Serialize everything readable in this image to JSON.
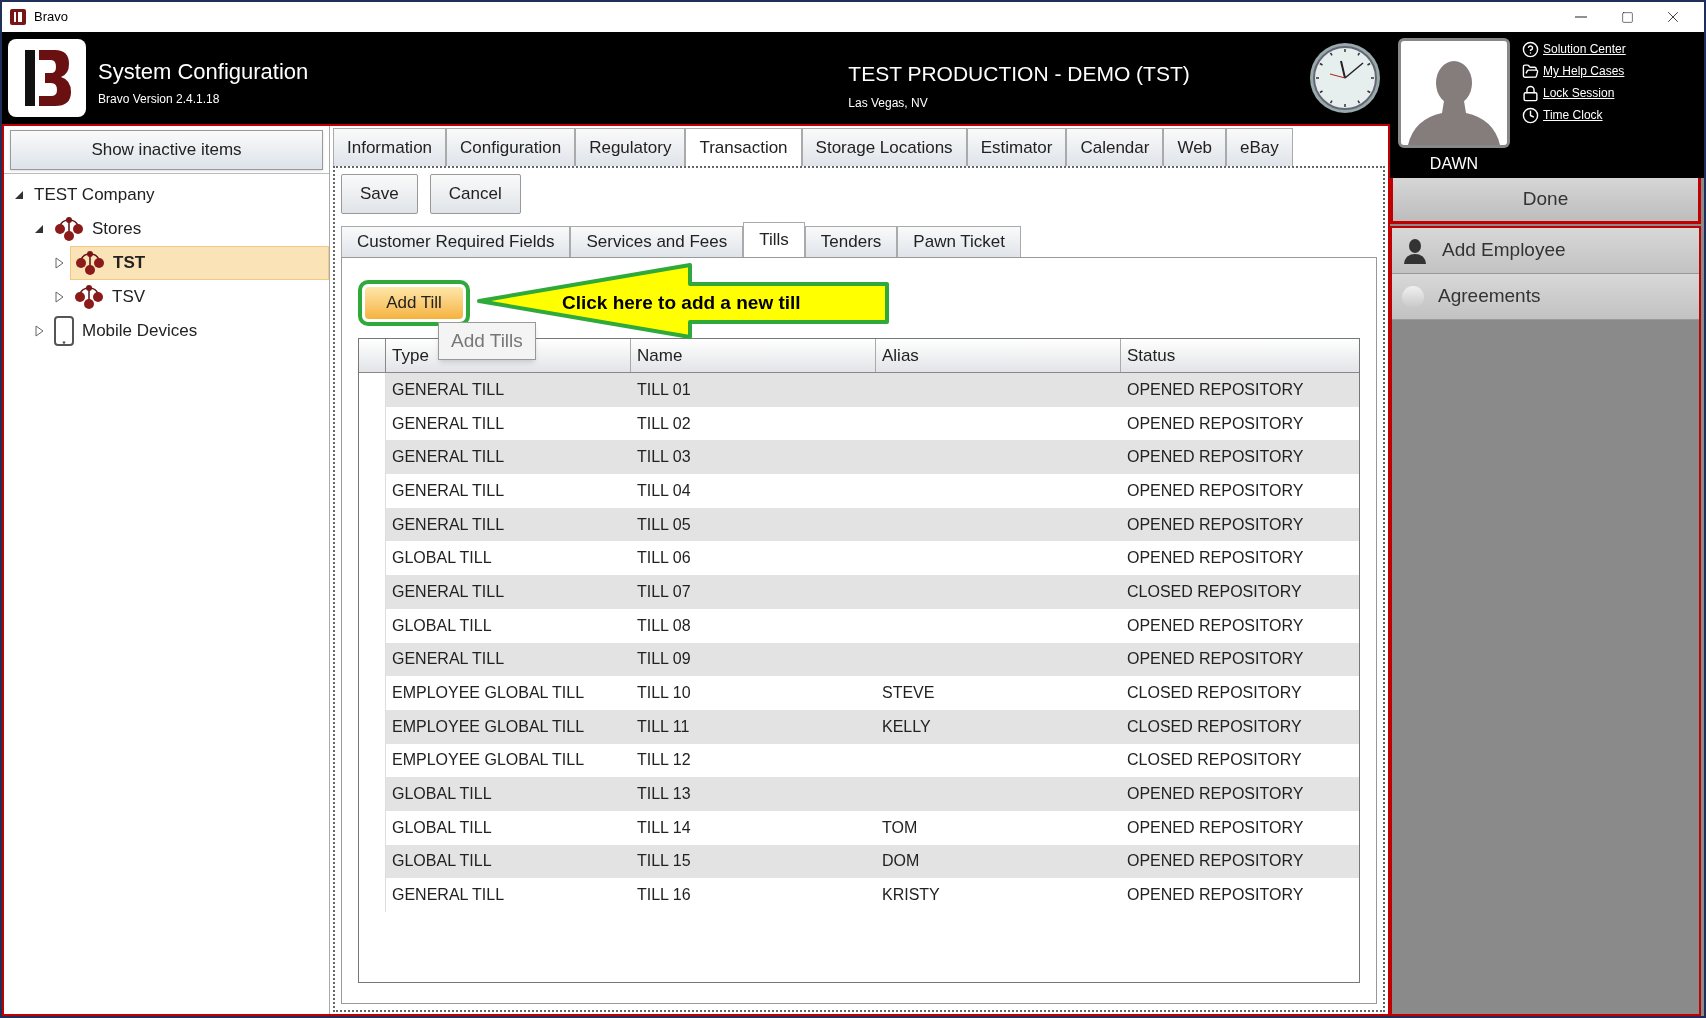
{
  "window": {
    "title": "Bravo"
  },
  "header": {
    "app_title": "System Configuration",
    "version": "Bravo Version 2.4.1.18",
    "company_title": "TEST PRODUCTION - DEMO (TST)",
    "location": "Las Vegas, NV",
    "user_name": "DAWN",
    "links": [
      {
        "label": "Solution Center",
        "kind": "help"
      },
      {
        "label": "My Help Cases",
        "kind": "folder"
      },
      {
        "label": "Lock Session",
        "kind": "lock"
      },
      {
        "label": "Time Clock",
        "kind": "clock"
      }
    ]
  },
  "sidebar": {
    "button": "Show inactive items",
    "tree": [
      {
        "label": "TEST Company",
        "expanded": true,
        "selected": false,
        "children": [
          {
            "label": "Stores",
            "kind": "stores",
            "expanded": true,
            "selected": false,
            "children": [
              {
                "label": "TST",
                "kind": "store",
                "expanded": false,
                "selected": true
              },
              {
                "label": "TSV",
                "kind": "store",
                "expanded": false,
                "selected": false
              }
            ]
          },
          {
            "label": "Mobile Devices",
            "kind": "device",
            "expanded": false,
            "selected": false
          }
        ]
      }
    ]
  },
  "tabs": [
    {
      "label": "Information",
      "selected": false
    },
    {
      "label": "Configuration",
      "selected": false
    },
    {
      "label": "Regulatory",
      "selected": false
    },
    {
      "label": "Transaction",
      "selected": true
    },
    {
      "label": "Storage Locations",
      "selected": false
    },
    {
      "label": "Estimator",
      "selected": false
    },
    {
      "label": "Calendar",
      "selected": false
    },
    {
      "label": "Web",
      "selected": false
    },
    {
      "label": "eBay",
      "selected": false
    }
  ],
  "toolbar": [
    "Save",
    "Cancel"
  ],
  "subtabs": [
    {
      "label": "Customer Required Fields",
      "selected": false
    },
    {
      "label": "Services and Fees",
      "selected": false
    },
    {
      "label": "Tills",
      "selected": true
    },
    {
      "label": "Tenders",
      "selected": false
    },
    {
      "label": "Pawn Ticket",
      "selected": false
    }
  ],
  "add_button": "Add Till",
  "tooltip": "Add Tills",
  "callout": "Click here to add a new till",
  "table": {
    "columns": [
      "Type",
      "Name",
      "Alias",
      "Status"
    ],
    "rows": [
      [
        "GENERAL TILL",
        "TILL 01",
        "",
        "OPENED REPOSITORY"
      ],
      [
        "GENERAL TILL",
        "TILL 02",
        "",
        "OPENED REPOSITORY"
      ],
      [
        "GENERAL TILL",
        "TILL 03",
        "",
        "OPENED REPOSITORY"
      ],
      [
        "GENERAL TILL",
        "TILL 04",
        "",
        "OPENED REPOSITORY"
      ],
      [
        "GENERAL TILL",
        "TILL 05",
        "",
        "OPENED REPOSITORY"
      ],
      [
        "GLOBAL TILL",
        "TILL 06",
        "",
        "OPENED REPOSITORY"
      ],
      [
        "GENERAL TILL",
        "TILL 07",
        "",
        "CLOSED REPOSITORY"
      ],
      [
        "GLOBAL TILL",
        "TILL 08",
        "",
        "OPENED REPOSITORY"
      ],
      [
        "GENERAL TILL",
        "TILL 09",
        "",
        "OPENED REPOSITORY"
      ],
      [
        "EMPLOYEE GLOBAL TILL",
        "TILL 10",
        "STEVE",
        "CLOSED REPOSITORY"
      ],
      [
        "EMPLOYEE GLOBAL TILL",
        "TILL 11",
        "KELLY",
        "CLOSED REPOSITORY"
      ],
      [
        "EMPLOYEE GLOBAL TILL",
        "TILL 12",
        "",
        "CLOSED REPOSITORY"
      ],
      [
        "GLOBAL TILL",
        "TILL 13",
        "",
        "OPENED REPOSITORY"
      ],
      [
        "GLOBAL TILL",
        "TILL 14",
        "TOM",
        "OPENED REPOSITORY"
      ],
      [
        "GLOBAL TILL",
        "TILL 15",
        "DOM",
        "OPENED REPOSITORY"
      ],
      [
        "GENERAL TILL",
        "TILL 16",
        "KRISTY",
        "OPENED REPOSITORY"
      ]
    ]
  },
  "right_panel": {
    "done": "Done",
    "items": [
      {
        "label": "Add Employee",
        "kind": "person"
      },
      {
        "label": "Agreements",
        "kind": "dot"
      }
    ]
  }
}
